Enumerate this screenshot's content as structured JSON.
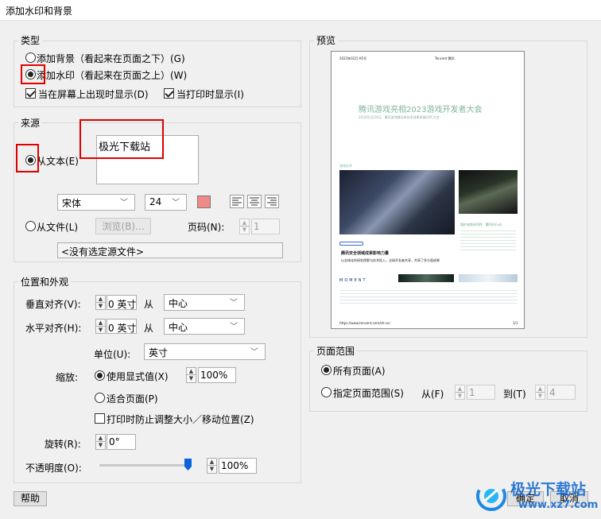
{
  "window": {
    "title": "添加水印和背景"
  },
  "type_section": {
    "label": "类型",
    "bg_option": "添加背景（看起来在页面之下）(G)",
    "wm_option": "添加水印（看起来在页面之上）(W)",
    "screen_check": "当在屏幕上出现时显示(D)",
    "print_check": "当打印时显示(I)"
  },
  "source_section": {
    "label": "来源",
    "text_option": "从文本(E)",
    "text_value": "极光下载站",
    "font": "宋体",
    "size": "24",
    "color": "#f08a8a",
    "file_option": "从文件(L)",
    "browse_label": "浏览(B)...",
    "page_label": "页码(N):",
    "page_value": "1",
    "file_placeholder": "<没有选定源文件>"
  },
  "position_section": {
    "label": "位置和外观",
    "vertical_label": "垂直对齐(V):",
    "vertical_value": "0 英寸",
    "from1": "从",
    "vertical_anchor": "中心",
    "horizontal_label": "水平对齐(H):",
    "horizontal_value": "0 英寸",
    "from2": "从",
    "horizontal_anchor": "中心",
    "unit_label": "单位(U):",
    "unit_value": "英寸",
    "scale_label": "缩放:",
    "display_value_option": "使用显式值(X)",
    "scale_value": "100%",
    "fit_page_option": "适合页面(P)",
    "print_lock_check": "打印时防止调整大小／移动位置(Z)",
    "rotate_label": "旋转(R):",
    "rotate_value": "0°",
    "opacity_label": "不透明度(O):",
    "opacity_value": "100%",
    "opacity_level": 1.0
  },
  "preview_section": {
    "label": "预览",
    "page": {
      "header_left": "2023年02月 H5号",
      "header_right": "Tencent 腾讯",
      "headline": "腾讯游戏亮相2023游戏开发者大会",
      "subline": "3月20日至24日，腾讯游戏携全新技术成果参展GDC大会",
      "caption1": "游戏技术",
      "side_title": "践护安航系列性 · 腾讯在行动",
      "article_title": "腾讯安全领域成果影响力量",
      "article_body": "以全球化的研发视野与技术投入，全球开发者共享，共享了多方面成果",
      "footer_title": "MOMENT",
      "footer_url": "https://www.tencent.com/zh-cn/",
      "footer_page": "1/1"
    }
  },
  "page_range_section": {
    "label": "页面范围",
    "all_pages": "所有页面(A)",
    "specific_pages": "指定页面范围(S)",
    "from_label": "从(F)",
    "from_value": "1",
    "to_label": "到(T)",
    "to_value": "4"
  },
  "footer": {
    "help": "帮助",
    "ok": "确定",
    "cancel": "取消",
    "watermark_brand": "极光下载站",
    "watermark_url": "www.xz7.com"
  }
}
